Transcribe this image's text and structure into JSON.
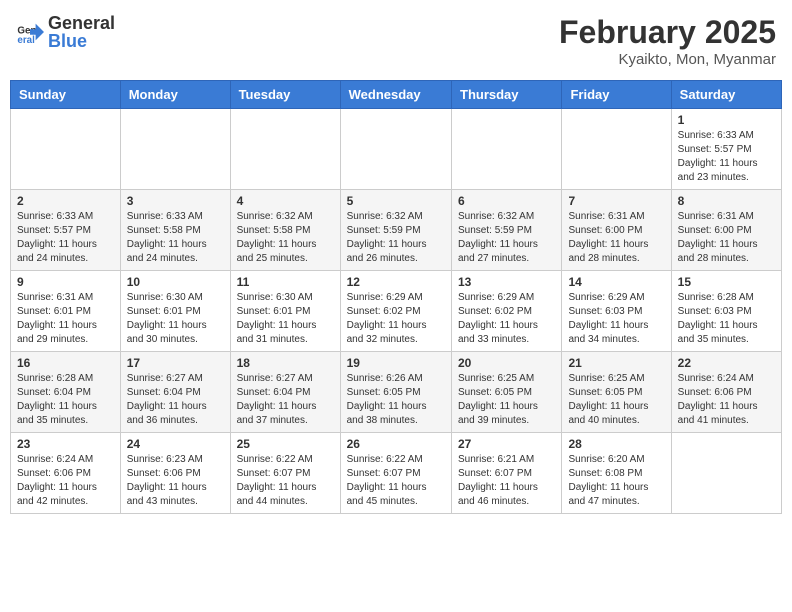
{
  "header": {
    "logo_general": "General",
    "logo_blue": "Blue",
    "main_title": "February 2025",
    "sub_title": "Kyaikto, Mon, Myanmar"
  },
  "calendar": {
    "days_of_week": [
      "Sunday",
      "Monday",
      "Tuesday",
      "Wednesday",
      "Thursday",
      "Friday",
      "Saturday"
    ],
    "weeks": [
      [
        {
          "day": "",
          "info": ""
        },
        {
          "day": "",
          "info": ""
        },
        {
          "day": "",
          "info": ""
        },
        {
          "day": "",
          "info": ""
        },
        {
          "day": "",
          "info": ""
        },
        {
          "day": "",
          "info": ""
        },
        {
          "day": "1",
          "info": "Sunrise: 6:33 AM\nSunset: 5:57 PM\nDaylight: 11 hours and 23 minutes."
        }
      ],
      [
        {
          "day": "2",
          "info": "Sunrise: 6:33 AM\nSunset: 5:57 PM\nDaylight: 11 hours and 24 minutes."
        },
        {
          "day": "3",
          "info": "Sunrise: 6:33 AM\nSunset: 5:58 PM\nDaylight: 11 hours and 24 minutes."
        },
        {
          "day": "4",
          "info": "Sunrise: 6:32 AM\nSunset: 5:58 PM\nDaylight: 11 hours and 25 minutes."
        },
        {
          "day": "5",
          "info": "Sunrise: 6:32 AM\nSunset: 5:59 PM\nDaylight: 11 hours and 26 minutes."
        },
        {
          "day": "6",
          "info": "Sunrise: 6:32 AM\nSunset: 5:59 PM\nDaylight: 11 hours and 27 minutes."
        },
        {
          "day": "7",
          "info": "Sunrise: 6:31 AM\nSunset: 6:00 PM\nDaylight: 11 hours and 28 minutes."
        },
        {
          "day": "8",
          "info": "Sunrise: 6:31 AM\nSunset: 6:00 PM\nDaylight: 11 hours and 28 minutes."
        }
      ],
      [
        {
          "day": "9",
          "info": "Sunrise: 6:31 AM\nSunset: 6:01 PM\nDaylight: 11 hours and 29 minutes."
        },
        {
          "day": "10",
          "info": "Sunrise: 6:30 AM\nSunset: 6:01 PM\nDaylight: 11 hours and 30 minutes."
        },
        {
          "day": "11",
          "info": "Sunrise: 6:30 AM\nSunset: 6:01 PM\nDaylight: 11 hours and 31 minutes."
        },
        {
          "day": "12",
          "info": "Sunrise: 6:29 AM\nSunset: 6:02 PM\nDaylight: 11 hours and 32 minutes."
        },
        {
          "day": "13",
          "info": "Sunrise: 6:29 AM\nSunset: 6:02 PM\nDaylight: 11 hours and 33 minutes."
        },
        {
          "day": "14",
          "info": "Sunrise: 6:29 AM\nSunset: 6:03 PM\nDaylight: 11 hours and 34 minutes."
        },
        {
          "day": "15",
          "info": "Sunrise: 6:28 AM\nSunset: 6:03 PM\nDaylight: 11 hours and 35 minutes."
        }
      ],
      [
        {
          "day": "16",
          "info": "Sunrise: 6:28 AM\nSunset: 6:04 PM\nDaylight: 11 hours and 35 minutes."
        },
        {
          "day": "17",
          "info": "Sunrise: 6:27 AM\nSunset: 6:04 PM\nDaylight: 11 hours and 36 minutes."
        },
        {
          "day": "18",
          "info": "Sunrise: 6:27 AM\nSunset: 6:04 PM\nDaylight: 11 hours and 37 minutes."
        },
        {
          "day": "19",
          "info": "Sunrise: 6:26 AM\nSunset: 6:05 PM\nDaylight: 11 hours and 38 minutes."
        },
        {
          "day": "20",
          "info": "Sunrise: 6:25 AM\nSunset: 6:05 PM\nDaylight: 11 hours and 39 minutes."
        },
        {
          "day": "21",
          "info": "Sunrise: 6:25 AM\nSunset: 6:05 PM\nDaylight: 11 hours and 40 minutes."
        },
        {
          "day": "22",
          "info": "Sunrise: 6:24 AM\nSunset: 6:06 PM\nDaylight: 11 hours and 41 minutes."
        }
      ],
      [
        {
          "day": "23",
          "info": "Sunrise: 6:24 AM\nSunset: 6:06 PM\nDaylight: 11 hours and 42 minutes."
        },
        {
          "day": "24",
          "info": "Sunrise: 6:23 AM\nSunset: 6:06 PM\nDaylight: 11 hours and 43 minutes."
        },
        {
          "day": "25",
          "info": "Sunrise: 6:22 AM\nSunset: 6:07 PM\nDaylight: 11 hours and 44 minutes."
        },
        {
          "day": "26",
          "info": "Sunrise: 6:22 AM\nSunset: 6:07 PM\nDaylight: 11 hours and 45 minutes."
        },
        {
          "day": "27",
          "info": "Sunrise: 6:21 AM\nSunset: 6:07 PM\nDaylight: 11 hours and 46 minutes."
        },
        {
          "day": "28",
          "info": "Sunrise: 6:20 AM\nSunset: 6:08 PM\nDaylight: 11 hours and 47 minutes."
        },
        {
          "day": "",
          "info": ""
        }
      ]
    ]
  }
}
